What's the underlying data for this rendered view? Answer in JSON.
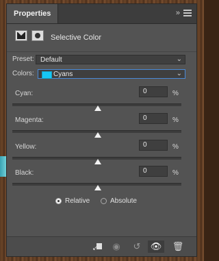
{
  "panel": {
    "tab_title": "Properties",
    "collapse_glyph": "»",
    "adjustment_name": "Selective Color"
  },
  "preset": {
    "label": "Preset:",
    "value": "Default"
  },
  "colors": {
    "label": "Colors:",
    "value": "Cyans",
    "swatch_color": "#16c7f5"
  },
  "sliders": [
    {
      "label": "Cyan:",
      "value": "0",
      "unit": "%"
    },
    {
      "label": "Magenta:",
      "value": "0",
      "unit": "%"
    },
    {
      "label": "Yellow:",
      "value": "0",
      "unit": "%"
    },
    {
      "label": "Black:",
      "value": "0",
      "unit": "%"
    }
  ],
  "method": {
    "relative_label": "Relative",
    "absolute_label": "Absolute",
    "selected": "Relative"
  },
  "footer_icons": [
    "clip-to-layer-icon",
    "view-previous-icon",
    "reset-icon",
    "visibility-eye-icon",
    "trash-icon"
  ],
  "colors_theme": {
    "panel_bg": "#535353",
    "accent": "#4a8ad8"
  }
}
